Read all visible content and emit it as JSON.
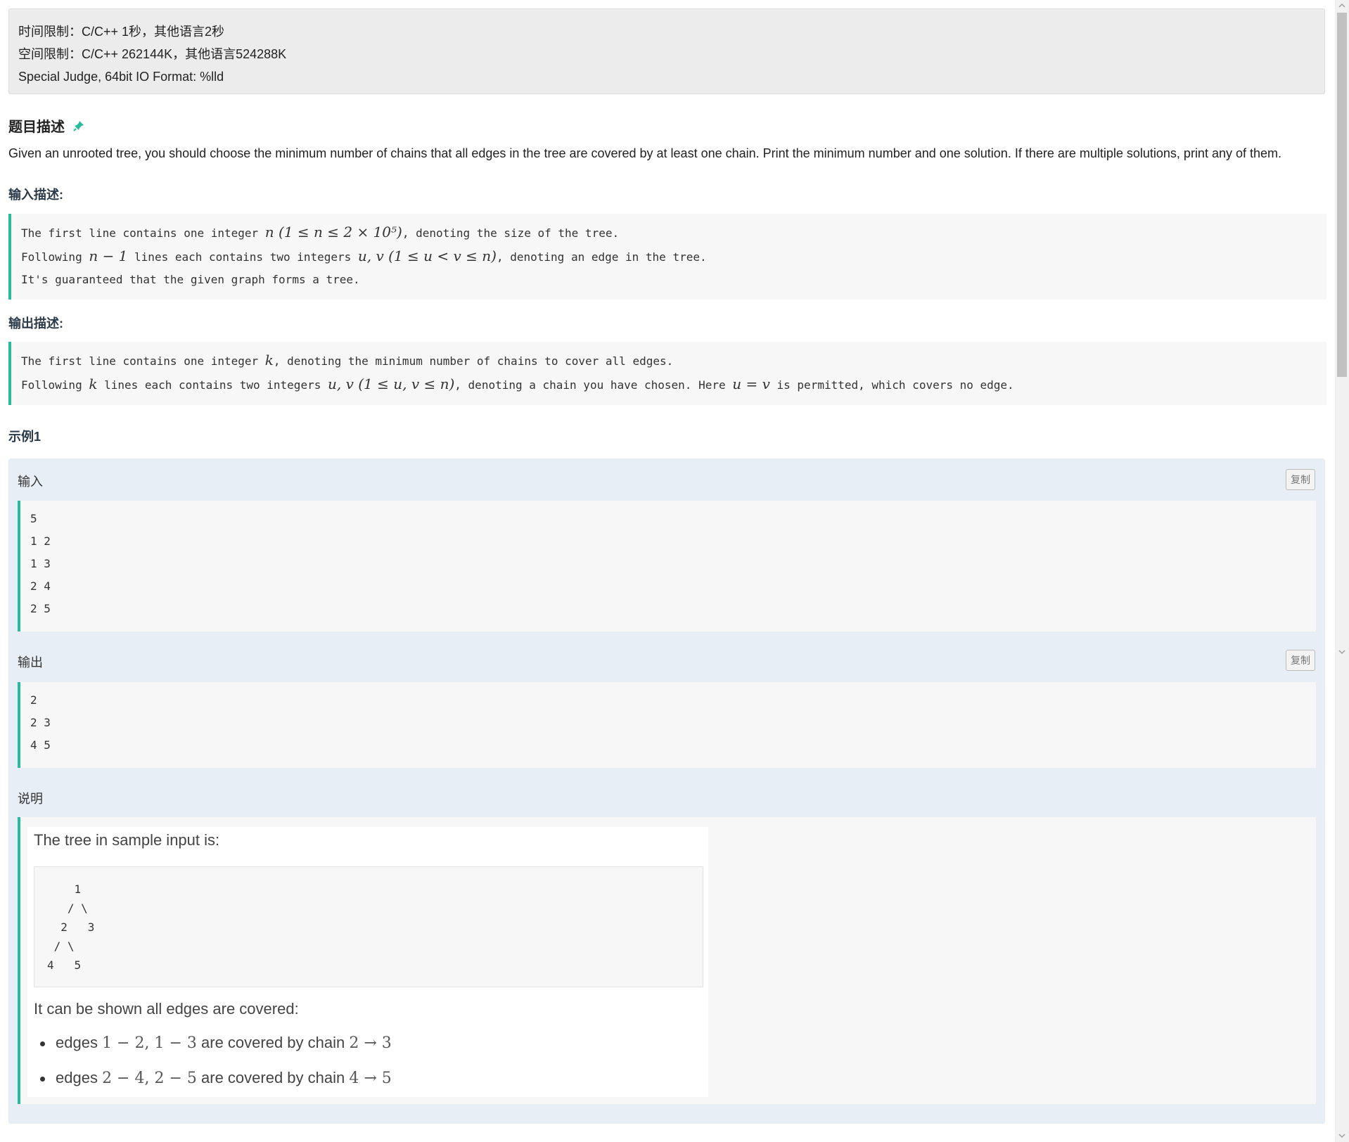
{
  "limits": {
    "time": "时间限制：C/C++ 1秒，其他语言2秒",
    "space": "空间限制：C/C++ 262144K，其他语言524288K",
    "judge": "Special Judge, 64bit IO Format: %lld"
  },
  "problem": {
    "title": "题目描述",
    "description": "Given an unrooted tree, you should choose the minimum number of chains that all edges in the tree are covered by at least one chain. Print the minimum number and one solution. If there are multiple solutions, print any of them."
  },
  "input": {
    "title": "输入描述:",
    "line1_a": "The first line contains one integer ",
    "line1_math": "n (1 ≤ n ≤ 2 × 10⁵)",
    "line1_b": ", denoting the size of the tree.",
    "line2_a": "Following ",
    "line2_math1": "n − 1",
    "line2_b": " lines each contains two integers ",
    "line2_math2": "u, v (1 ≤ u < v ≤ n)",
    "line2_c": ", denoting an edge in the tree.",
    "line3": "It's guaranteed that the given graph forms a tree."
  },
  "output": {
    "title": "输出描述:",
    "line1_a": "The first line contains one integer ",
    "line1_math": "k",
    "line1_b": ", denoting the minimum number of chains to cover all edges.",
    "line2_a": "Following ",
    "line2_math1": "k",
    "line2_b": " lines each contains two integers ",
    "line2_math2": "u, v (1 ≤ u, v ≤ n)",
    "line2_c": ", denoting a chain you have chosen. Here ",
    "line2_math3": "u = v",
    "line2_d": " is permitted, which covers no edge."
  },
  "example": {
    "title": "示例1",
    "input_label": "输入",
    "input_lines": [
      "5",
      "1 2",
      "1 3",
      "2 4",
      "2 5"
    ],
    "output_label": "输出",
    "output_lines": [
      "2",
      "2 3",
      "4 5"
    ],
    "copy_label": "复制",
    "explain_label": "说明",
    "explain_intro": "The tree in sample input is:",
    "tree_ascii": "    1\n   / \\\n  2   3\n / \\\n4   5",
    "explain_covered": "It can be shown all edges are covered:",
    "bullets": [
      {
        "a": "edges ",
        "m1": "1 − 2, 1 − 3",
        "b": " are covered by chain ",
        "m2": "2 → 3"
      },
      {
        "a": "edges ",
        "m1": "2 − 4, 2 − 5",
        "b": " are covered by chain ",
        "m2": "4 → 5"
      }
    ]
  },
  "colors": {
    "accent": "#25bb9b",
    "panel": "#e8eef5",
    "limits_bg": "#ececec"
  }
}
